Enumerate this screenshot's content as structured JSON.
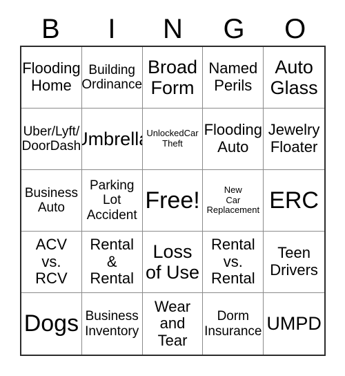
{
  "header": {
    "letters": [
      "B",
      "I",
      "N",
      "G",
      "O"
    ]
  },
  "grid": {
    "rows": 5,
    "columns": 5,
    "cells": [
      {
        "text": "Flooding\nHome",
        "size": "lg"
      },
      {
        "text": "Building\nOrdinance",
        "size": "md"
      },
      {
        "text": "Broad\nForm",
        "size": "xl"
      },
      {
        "text": "Named\nPerils",
        "size": "lg"
      },
      {
        "text": "Auto\nGlass",
        "size": "xl"
      },
      {
        "text": "Uber/Lyft/\nDoorDash",
        "size": "md"
      },
      {
        "text": "Umbrella",
        "size": "xl"
      },
      {
        "text": "UnlockedCar\nTheft",
        "size": "xs"
      },
      {
        "text": "Flooding\nAuto",
        "size": "lg"
      },
      {
        "text": "Jewelry\nFloater",
        "size": "lg"
      },
      {
        "text": "Business\nAuto",
        "size": "md"
      },
      {
        "text": "Parking\nLot\nAccident",
        "size": "md"
      },
      {
        "text": "Free!",
        "size": "xxl"
      },
      {
        "text": "New\nCar\nReplacement",
        "size": "xs"
      },
      {
        "text": "ERC",
        "size": "xxl"
      },
      {
        "text": "ACV\nvs.\nRCV",
        "size": "lg"
      },
      {
        "text": "Rental\n&\nRental",
        "size": "lg"
      },
      {
        "text": "Loss\nof Use",
        "size": "xl"
      },
      {
        "text": "Rental\nvs.\nRental",
        "size": "lg"
      },
      {
        "text": "Teen\nDrivers",
        "size": "lg"
      },
      {
        "text": "Dogs",
        "size": "xxl"
      },
      {
        "text": "Business\nInventory",
        "size": "md"
      },
      {
        "text": "Wear\nand\nTear",
        "size": "lg"
      },
      {
        "text": "Dorm\nInsurance",
        "size": "md"
      },
      {
        "text": "UMPD",
        "size": "xl"
      }
    ]
  }
}
